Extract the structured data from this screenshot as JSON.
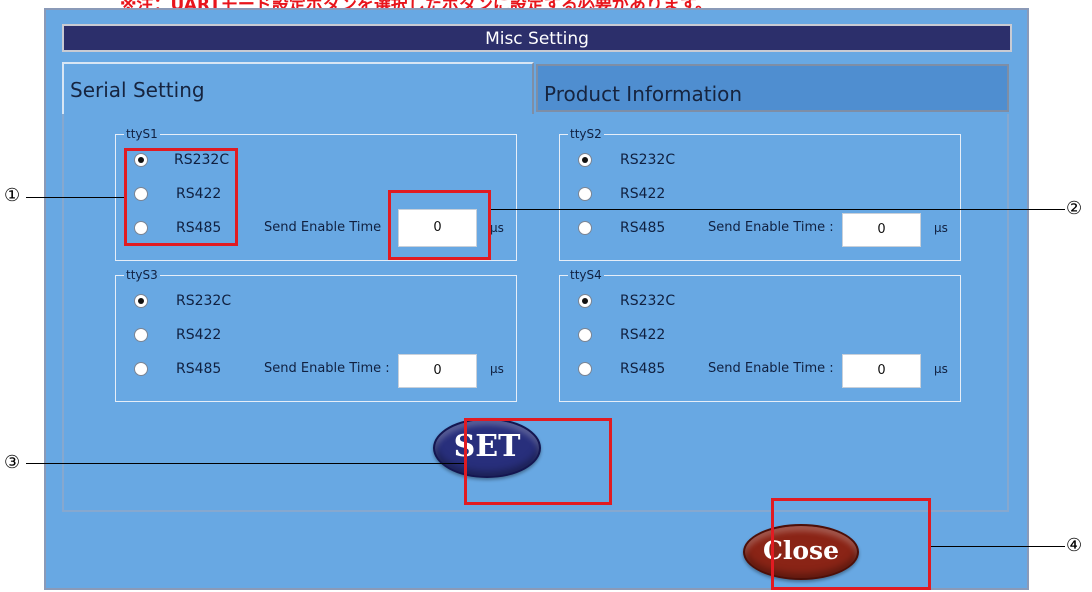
{
  "note": "※注：UARTモード設定ボタンを選択したボタンに設定する必要があります。",
  "window": {
    "title": "Misc Setting"
  },
  "tabs": [
    {
      "label": "Serial Setting",
      "active": true
    },
    {
      "label": "Product Information",
      "active": false
    }
  ],
  "groups": [
    {
      "name": "ttyS1",
      "send_label": "Send Enable Time",
      "value": "0",
      "unit": "μs",
      "selected": "RS232C"
    },
    {
      "name": "ttyS2",
      "send_label": "Send Enable Time :",
      "value": "0",
      "unit": "μs",
      "selected": "RS232C"
    },
    {
      "name": "ttyS3",
      "send_label": "Send Enable Time :",
      "value": "0",
      "unit": "μs",
      "selected": "RS232C"
    },
    {
      "name": "ttyS4",
      "send_label": "Send Enable Time :",
      "value": "0",
      "unit": "μs",
      "selected": "RS232C"
    }
  ],
  "modes": [
    "RS232C",
    "RS422",
    "RS485"
  ],
  "buttons": {
    "set": "SET",
    "close": "Close"
  },
  "callouts": [
    "①",
    "②",
    "③",
    "④"
  ],
  "colors": {
    "window_bg": "#68a8e3",
    "titlebar_bg": "#2c2f6b",
    "highlight_red": "#e11b22",
    "set_button": "#282f7c",
    "close_button": "#8a2416"
  }
}
